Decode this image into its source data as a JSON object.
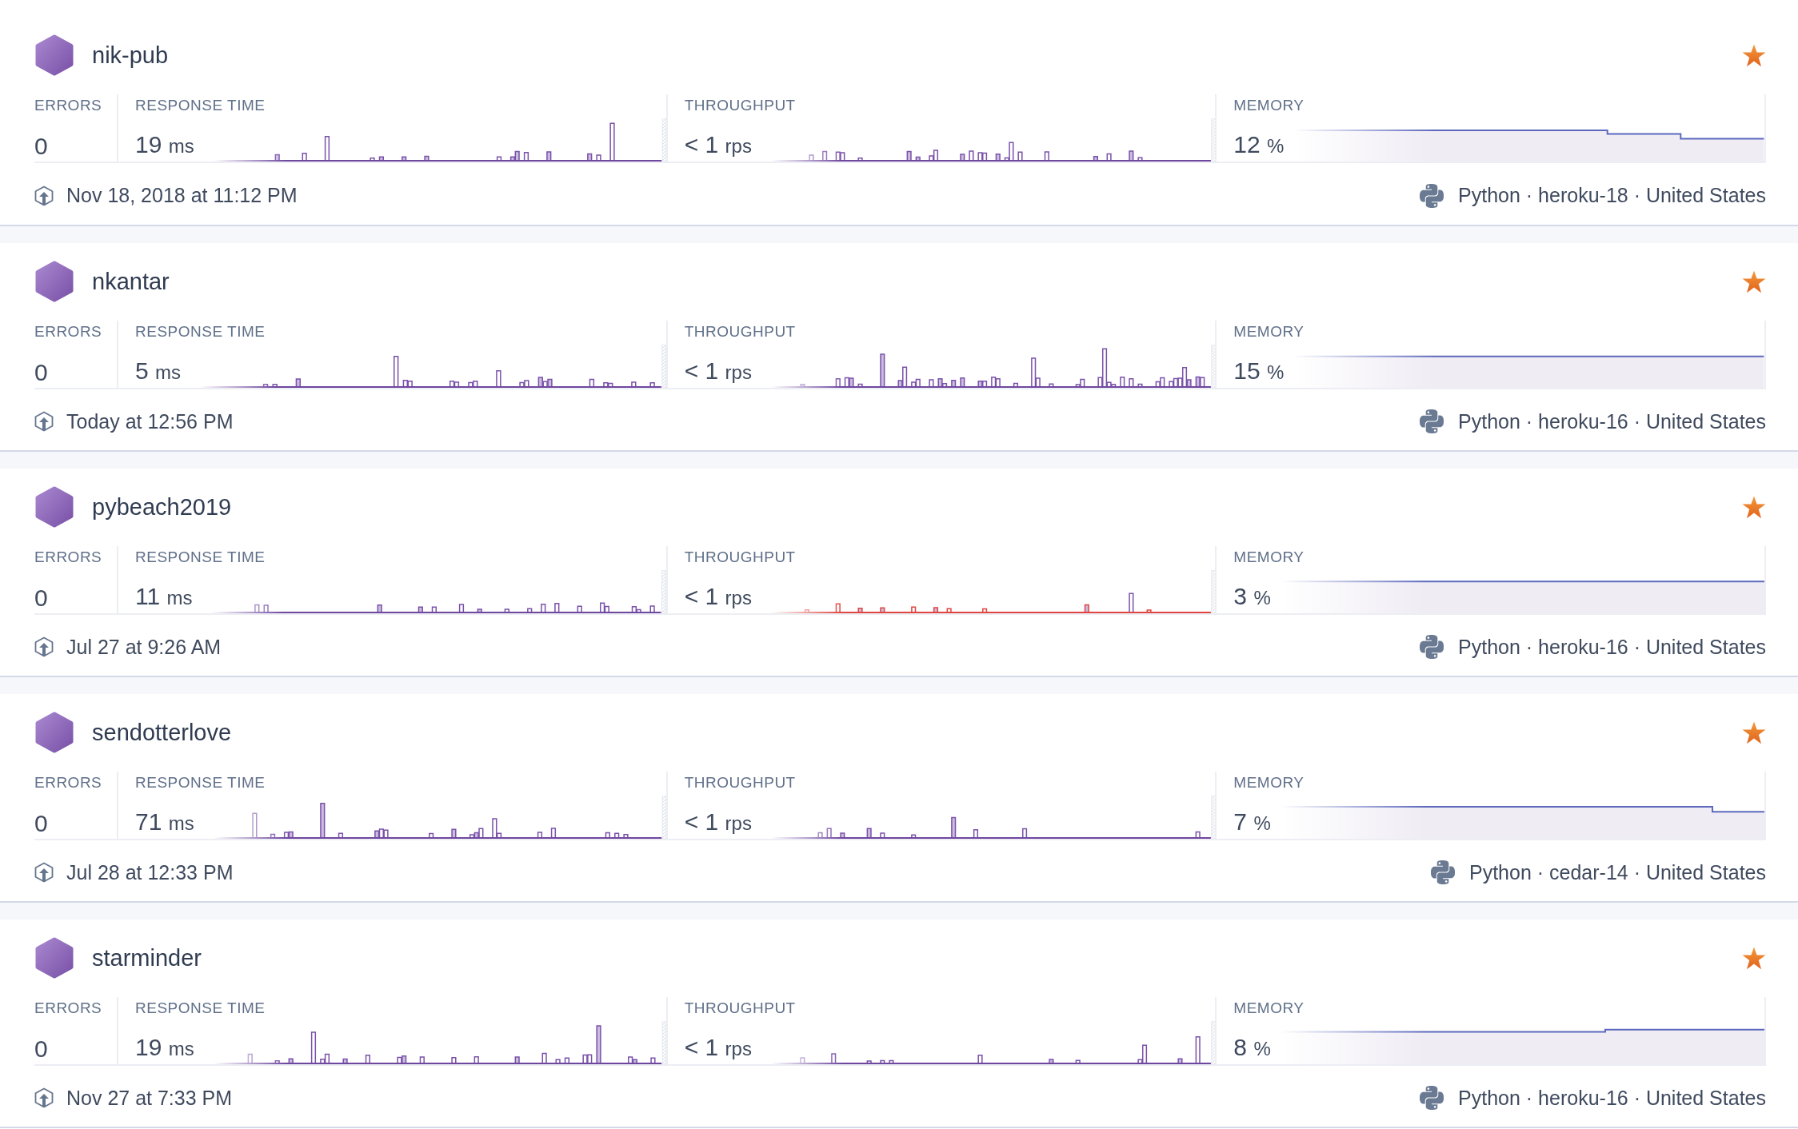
{
  "apps": [
    {
      "name": "nik-pub",
      "favorite": true,
      "metrics": [
        {
          "kind": "errors",
          "label": "ERRORS",
          "value": "0"
        },
        {
          "kind": "response_time",
          "label": "RESPONSE TIME",
          "value": "19",
          "unit": "ms"
        },
        {
          "kind": "throughput",
          "label": "THROUGHPUT",
          "value": "< 1",
          "unit": "rps",
          "error_highlight": false
        },
        {
          "kind": "memory",
          "label": "MEMORY",
          "value": "12",
          "unit": "%"
        }
      ],
      "last_deploy": "Nov 18, 2018 at 11:12 PM",
      "stack": "Python · heroku-18 · United States"
    },
    {
      "name": "nkantar",
      "favorite": true,
      "metrics": [
        {
          "kind": "errors",
          "label": "ERRORS",
          "value": "0"
        },
        {
          "kind": "response_time",
          "label": "RESPONSE TIME",
          "value": "5",
          "unit": "ms"
        },
        {
          "kind": "throughput",
          "label": "THROUGHPUT",
          "value": "< 1",
          "unit": "rps",
          "error_highlight": false
        },
        {
          "kind": "memory",
          "label": "MEMORY",
          "value": "15",
          "unit": "%"
        }
      ],
      "last_deploy": "Today at 12:56 PM",
      "stack": "Python · heroku-16 · United States"
    },
    {
      "name": "pybeach2019",
      "favorite": true,
      "metrics": [
        {
          "kind": "errors",
          "label": "ERRORS",
          "value": "0"
        },
        {
          "kind": "response_time",
          "label": "RESPONSE TIME",
          "value": "11",
          "unit": "ms"
        },
        {
          "kind": "throughput",
          "label": "THROUGHPUT",
          "value": "< 1",
          "unit": "rps",
          "error_highlight": true
        },
        {
          "kind": "memory",
          "label": "MEMORY",
          "value": "3",
          "unit": "%"
        }
      ],
      "last_deploy": "Jul 27 at 9:26 AM",
      "stack": "Python · heroku-16 · United States"
    },
    {
      "name": "sendotterlove",
      "favorite": true,
      "metrics": [
        {
          "kind": "errors",
          "label": "ERRORS",
          "value": "0"
        },
        {
          "kind": "response_time",
          "label": "RESPONSE TIME",
          "value": "71",
          "unit": "ms"
        },
        {
          "kind": "throughput",
          "label": "THROUGHPUT",
          "value": "< 1",
          "unit": "rps",
          "error_highlight": false
        },
        {
          "kind": "memory",
          "label": "MEMORY",
          "value": "7",
          "unit": "%"
        }
      ],
      "last_deploy": "Jul 28 at 12:33 PM",
      "stack": "Python · cedar-14 · United States"
    },
    {
      "name": "starminder",
      "favorite": true,
      "metrics": [
        {
          "kind": "errors",
          "label": "ERRORS",
          "value": "0"
        },
        {
          "kind": "response_time",
          "label": "RESPONSE TIME",
          "value": "19",
          "unit": "ms"
        },
        {
          "kind": "throughput",
          "label": "THROUGHPUT",
          "value": "< 1",
          "unit": "rps",
          "error_highlight": false
        },
        {
          "kind": "memory",
          "label": "MEMORY",
          "value": "8",
          "unit": "%"
        }
      ],
      "last_deploy": "Nov 27 at 7:33 PM",
      "stack": "Python · heroku-16 · United States"
    }
  ]
}
